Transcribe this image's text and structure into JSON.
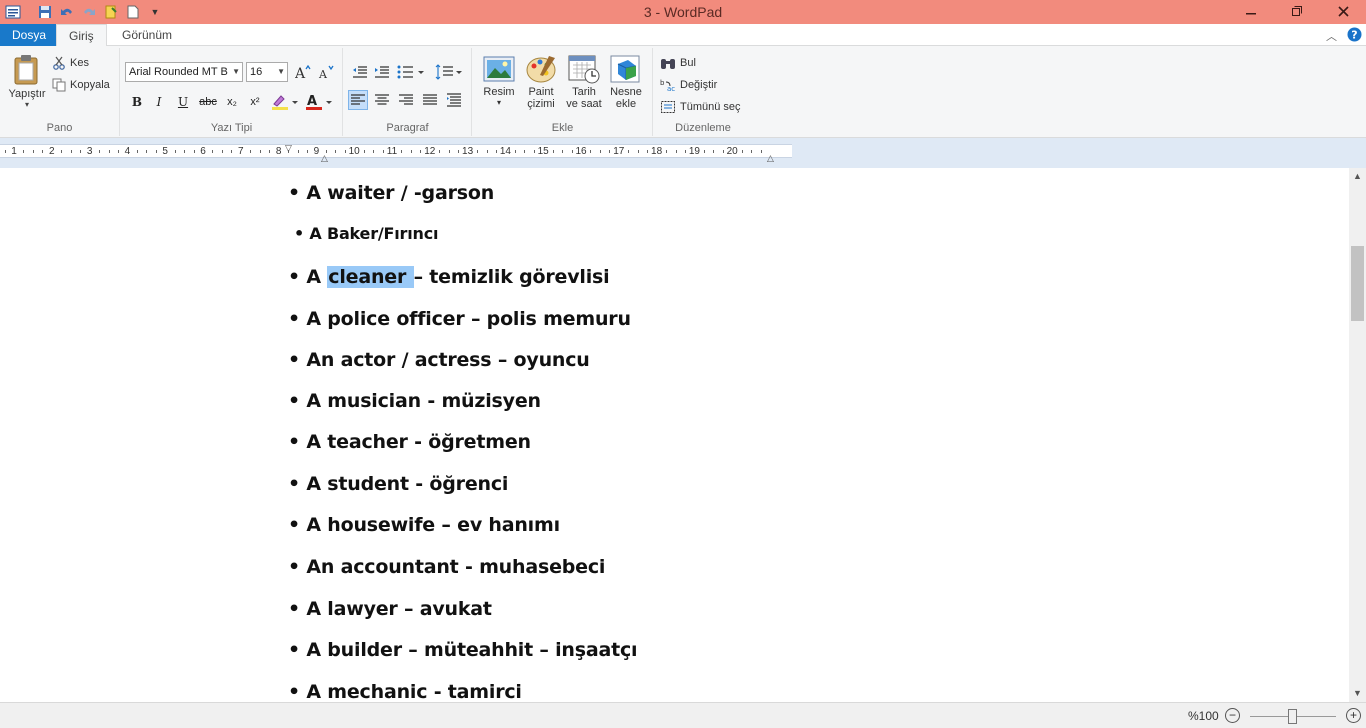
{
  "window": {
    "title": "3 - WordPad"
  },
  "tabs": {
    "file": "Dosya",
    "home": "Giriş",
    "view": "Görünüm"
  },
  "ribbon": {
    "clipboard": {
      "label": "Pano",
      "paste": "Yapıştır",
      "cut": "Kes",
      "copy": "Kopyala"
    },
    "font": {
      "label": "Yazı Tipi",
      "family": "Arial Rounded MT B",
      "size": "16",
      "bold": "B",
      "italic": "I",
      "underline": "U",
      "strike": "abc",
      "subscript": "x₂",
      "superscript": "x²"
    },
    "paragraph": {
      "label": "Paragraf"
    },
    "insert": {
      "label": "Ekle",
      "picture": "Resim",
      "paint_line1": "Paint",
      "paint_line2": "çizimi",
      "datetime_line1": "Tarih",
      "datetime_line2": "ve saat",
      "object_line1": "Nesne",
      "object_line2": "ekle"
    },
    "editing": {
      "label": "Düzenleme",
      "find": "Bul",
      "replace": "Değiştir",
      "select_all": "Tümünü seç"
    }
  },
  "ruler": {
    "numbers": [
      "1",
      "2",
      "3",
      "4",
      "5",
      "6",
      "7",
      "8",
      "9",
      "10",
      "11",
      "12",
      "13",
      "14",
      "15",
      "16",
      "17",
      "18",
      "19",
      "20"
    ]
  },
  "document": {
    "lines": [
      {
        "before": "• A waiter /  -garson",
        "sel": "",
        "after": ""
      },
      {
        "before": "• A Baker/Fırıncı",
        "sel": "",
        "after": ""
      },
      {
        "before": "• A ",
        "sel": "cleaner ",
        "after": "– temizlik görevlisi"
      },
      {
        "before": "• A police officer – polis memuru",
        "sel": "",
        "after": ""
      },
      {
        "before": "• An actor / actress – oyuncu",
        "sel": "",
        "after": ""
      },
      {
        "before": "• A musician - müzisyen",
        "sel": "",
        "after": ""
      },
      {
        "before": "• A teacher - öğretmen",
        "sel": "",
        "after": ""
      },
      {
        "before": "• A student - öğrenci",
        "sel": "",
        "after": ""
      },
      {
        "before": "• A housewife – ev hanımı",
        "sel": "",
        "after": ""
      },
      {
        "before": "• An accountant - muhasebeci",
        "sel": "",
        "after": ""
      },
      {
        "before": "• A lawyer – avukat",
        "sel": "",
        "after": ""
      },
      {
        "before": "• A builder – müteahhit – inşaatçı",
        "sel": "",
        "after": ""
      },
      {
        "before": "• A mechanic - tamirci",
        "sel": "",
        "after": ""
      }
    ]
  },
  "status": {
    "zoom": "%100",
    "zoom_out": "−",
    "zoom_in": "+"
  },
  "colors": {
    "titlebar": "#f28b7d",
    "file_tab": "#1979ca",
    "selection": "#99c9f7",
    "highlight": "#f4e14a",
    "font_color": "#d8261c"
  }
}
